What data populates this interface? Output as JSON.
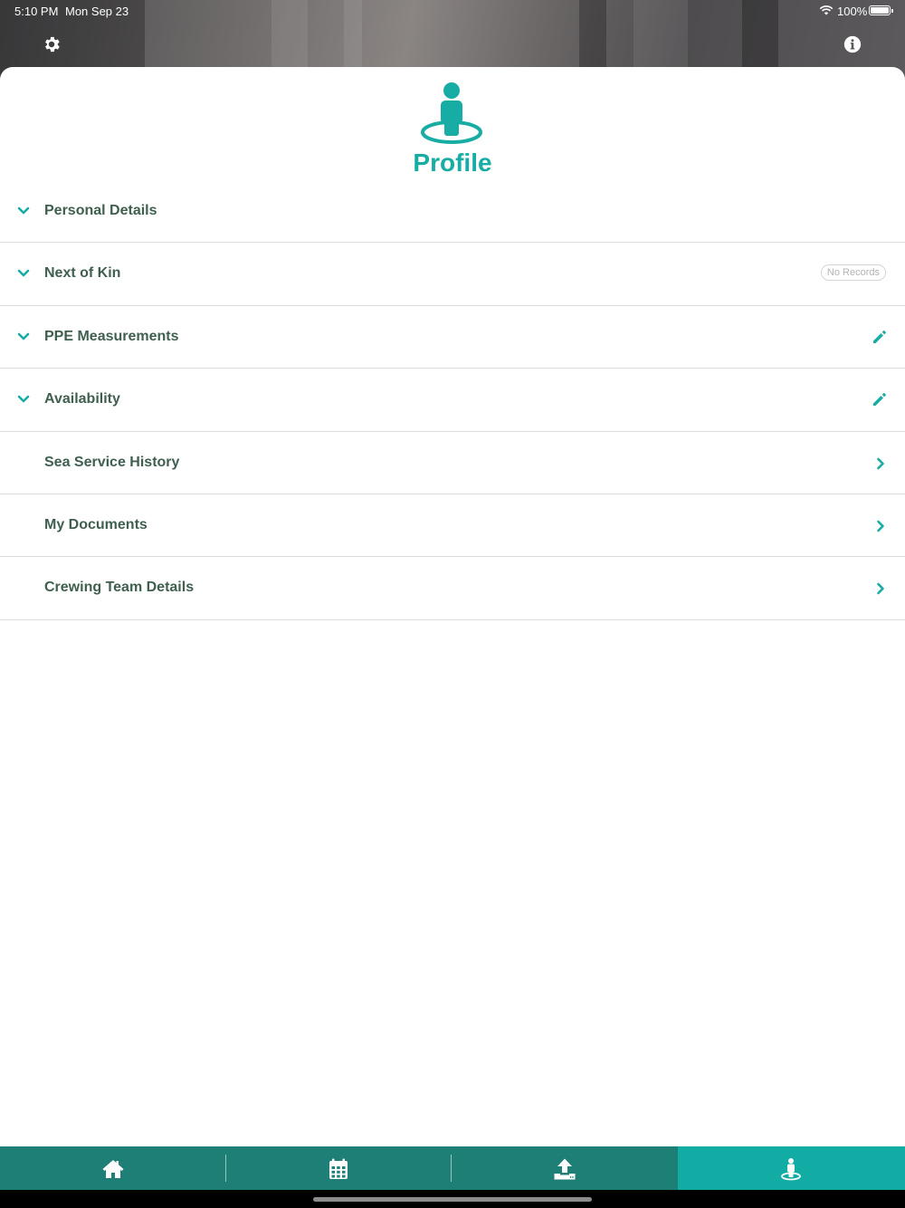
{
  "status_bar": {
    "time": "5:10 PM",
    "date": "Mon Sep 23",
    "battery_percent": "100%"
  },
  "header": {
    "settings_icon": "gear-icon",
    "info_icon": "info-icon"
  },
  "profile": {
    "icon": "person-on-ring-icon",
    "title": "Profile"
  },
  "sections": [
    {
      "label": "Personal Details",
      "expander": "chevron-down-icon",
      "trailing": ""
    },
    {
      "label": "Next of Kin",
      "expander": "chevron-down-icon",
      "trailing": "badge",
      "badge": "No Records"
    },
    {
      "label": "PPE Measurements",
      "expander": "chevron-down-icon",
      "trailing": "pencil-icon"
    },
    {
      "label": "Availability",
      "expander": "chevron-down-icon",
      "trailing": "pencil-icon"
    },
    {
      "label": "Sea Service History",
      "expander": "",
      "trailing": "chevron-right-icon"
    },
    {
      "label": "My Documents",
      "expander": "",
      "trailing": "chevron-right-icon"
    },
    {
      "label": "Crewing Team Details",
      "expander": "",
      "trailing": "chevron-right-icon"
    }
  ],
  "tab_bar": {
    "tabs": [
      {
        "icon": "home-icon",
        "active": false
      },
      {
        "icon": "calendar-icon",
        "active": false
      },
      {
        "icon": "upload-icon",
        "active": false
      },
      {
        "icon": "profile-icon",
        "active": true
      }
    ]
  },
  "colors": {
    "accent": "#17ada5",
    "tab_bar": "#1e7f77",
    "tab_active": "#11ada4",
    "label_text": "#3f5f4f"
  }
}
